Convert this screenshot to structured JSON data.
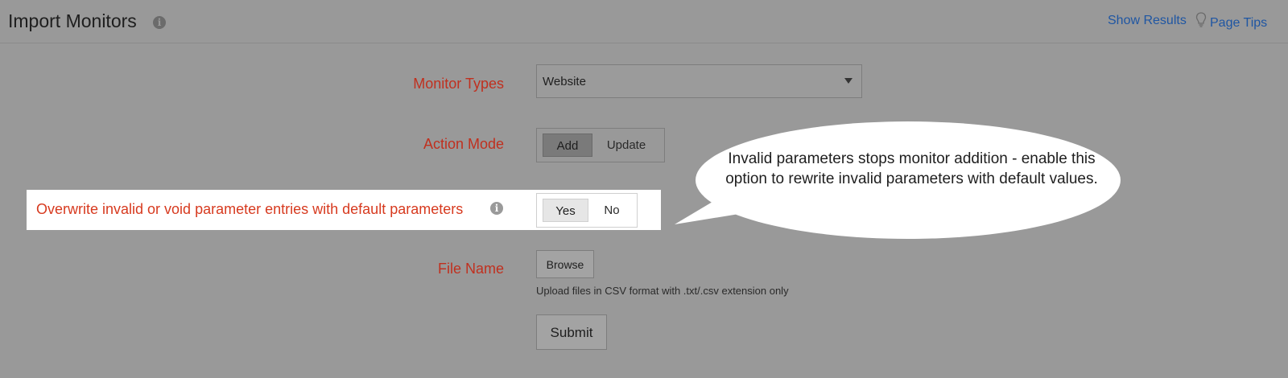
{
  "header": {
    "title": "Import Monitors",
    "info_icon": "info-icon",
    "show_results": "Show Results",
    "page_tips": "Page Tips",
    "tips_icon": "lightbulb-icon",
    "link_color": "#1f56a3"
  },
  "form": {
    "monitor_types": {
      "label": "Monitor Types",
      "value": "Website"
    },
    "action_mode": {
      "label": "Action Mode",
      "options": [
        "Add",
        "Update"
      ],
      "selected": "Add"
    },
    "overwrite": {
      "label": "Overwrite invalid or void parameter entries with default parameters",
      "options": [
        "Yes",
        "No"
      ],
      "selected": "Yes"
    },
    "file_name": {
      "label": "File Name",
      "browse": "Browse",
      "hint": "Upload files in CSV format with .txt/.csv extension only"
    },
    "submit": "Submit",
    "label_color": "#c0301f"
  },
  "callout": {
    "text": "Invalid parameters stops monitor addition - enable this option to rewrite invalid parameters with default values."
  }
}
